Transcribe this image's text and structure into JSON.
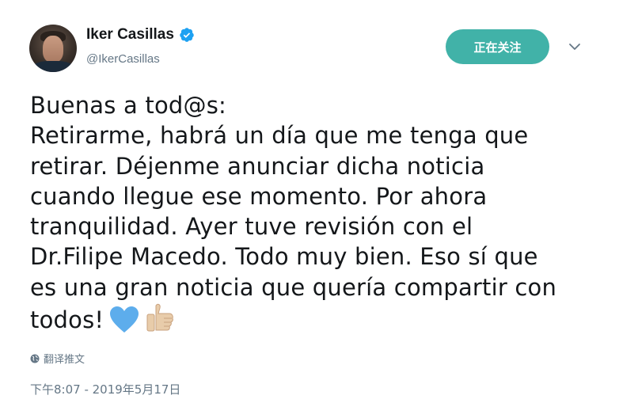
{
  "author": {
    "display_name": "Iker Casillas",
    "handle": "@IkerCasillas",
    "verified": true
  },
  "follow_button": {
    "label": "正在关注"
  },
  "tweet": {
    "lines": [
      "Buenas a tod@s:",
      "Retirarme, habrá un día que me tenga que",
      "retirar. Déjenme anunciar dicha noticia",
      "cuando llegue ese momento. Por ahora",
      "tranquilidad. Ayer tuve revisión con el",
      "Dr.Filipe Macedo. Todo muy bien. Eso sí que",
      "es una gran noticia que quería compartir con",
      "todos!"
    ],
    "emojis": [
      "blue-heart",
      "thumbs-up"
    ]
  },
  "translate": {
    "label": "翻译推文"
  },
  "timestamp": "下午8:07 - 2019年5月17日",
  "colors": {
    "follow_bg": "#41b2a8",
    "verified": "#1da1f2",
    "secondary_text": "#657786"
  }
}
